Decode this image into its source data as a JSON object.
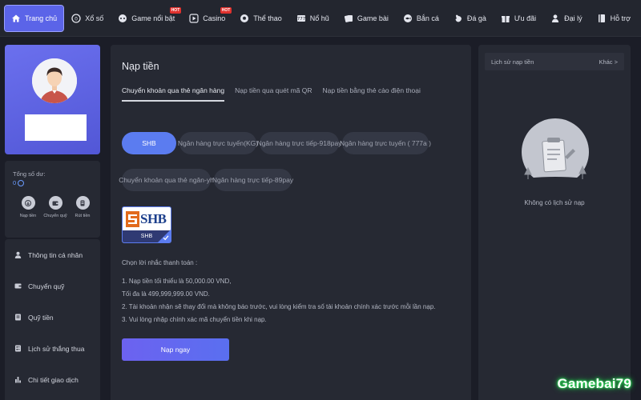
{
  "nav": {
    "items": [
      {
        "label": "Trang chủ",
        "icon": "home-icon",
        "active": true
      },
      {
        "label": "Xổ số",
        "icon": "lottery-icon"
      },
      {
        "label": "Game nổi bật",
        "icon": "gamepad-icon",
        "badge": "HOT"
      },
      {
        "label": "Casino",
        "icon": "play-icon",
        "badge": "HOT"
      },
      {
        "label": "Thể thao",
        "icon": "ball-icon"
      },
      {
        "label": "Nổ hũ",
        "icon": "slot-icon"
      },
      {
        "label": "Game bài",
        "icon": "cards-icon"
      },
      {
        "label": "Bắn cá",
        "icon": "fish-icon"
      },
      {
        "label": "Đá gà",
        "icon": "rooster-icon"
      },
      {
        "label": "Ưu đãi",
        "icon": "gift-icon"
      },
      {
        "label": "Đại lý",
        "icon": "agent-icon"
      },
      {
        "label": "Hỗ trợ",
        "icon": "book-icon"
      }
    ]
  },
  "account": {
    "balance_label": "Tổng số dư:",
    "balance_value": "0",
    "quick_actions": [
      {
        "label": "Nạp tiền",
        "icon": "deposit-icon"
      },
      {
        "label": "Chuyển quỹ",
        "icon": "wallet-icon"
      },
      {
        "label": "Rút tiền",
        "icon": "withdraw-icon"
      }
    ]
  },
  "sidebar": {
    "items": [
      {
        "label": "Thông tin cá nhân",
        "icon": "user-icon"
      },
      {
        "label": "Chuyển quỹ",
        "icon": "transfer-icon"
      },
      {
        "label": "Quỹ tiền",
        "icon": "fund-icon"
      },
      {
        "label": "Lịch sử thắng thua",
        "icon": "history-icon"
      },
      {
        "label": "Chi tiết giao dịch",
        "icon": "chart-icon"
      }
    ]
  },
  "deposit": {
    "title": "Nạp tiền",
    "tabs": [
      {
        "label": "Chuyển khoản qua thẻ ngân hàng",
        "active": true
      },
      {
        "label": "Nạp tiền qua quét mã QR"
      },
      {
        "label": "Nạp tiền bằng thẻ cào điện thoại"
      }
    ],
    "methods": [
      {
        "label": "SHB",
        "active": true
      },
      {
        "label": "Ngân hàng trực tuyến(KG)"
      },
      {
        "label": "Ngân hàng trực tiếp-918pay"
      },
      {
        "label": "Ngân hàng trực tuyến ( 777a )"
      },
      {
        "label": "Chuyển khoản qua thẻ ngân-yh"
      },
      {
        "label": "Ngân hàng trực tiếp-89pay"
      }
    ],
    "bank": {
      "logo_text": "SHB",
      "name": "SHB",
      "selected": true
    },
    "instructions_title": "Chọn lời nhắc thanh toán :",
    "instructions": [
      "1. Nạp tiền tối thiểu là 50,000.00 VND,",
      "Tối đa là 499,999,999.00 VND.",
      "2. Tài khoản nhận sẽ thay đổi mà không báo trước, vui lòng kiểm tra số tài khoản chính xác trước mỗi lần nạp.",
      "3. Vui lòng nhập chính xác mã chuyển tiền khi nạp."
    ],
    "submit_label": "Nạp ngay"
  },
  "history": {
    "title": "Lịch sử nạp tiền",
    "more_label": "Khác >",
    "empty_text": "Không có lịch sử nạp"
  },
  "watermark": "Gamebai79",
  "colors": {
    "accent": "#5b64e8",
    "button": "#6c62f0",
    "panel": "#262933",
    "background": "#1b1d27"
  }
}
